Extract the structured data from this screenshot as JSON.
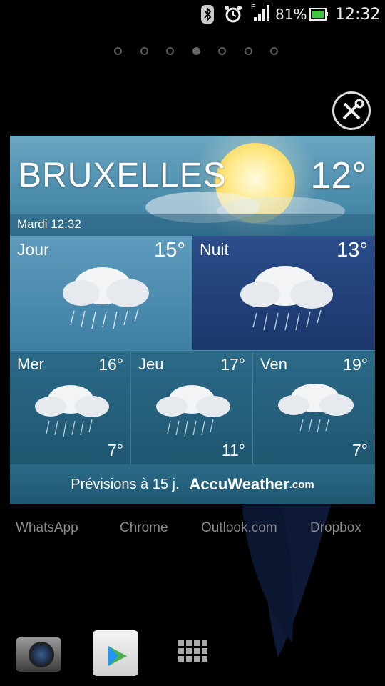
{
  "status_bar": {
    "battery_percent": "81%",
    "time": "12:32",
    "network_label": "E",
    "icons": [
      "bluetooth-icon",
      "alarm-icon",
      "signal-icon",
      "battery-icon"
    ]
  },
  "home": {
    "page_count": 7,
    "active_page": 3,
    "app_labels": [
      "WhatsApp",
      "Chrome",
      "Outlook.com",
      "Dropbox"
    ]
  },
  "widget": {
    "city": "BRUXELLES",
    "current_temp": "12°",
    "date_time": "Mardi 12:32",
    "today": {
      "label": "Jour",
      "temp": "15°"
    },
    "night": {
      "label": "Nuit",
      "temp": "13°"
    },
    "forecast": [
      {
        "day": "Mer",
        "high": "16°",
        "low": "7°"
      },
      {
        "day": "Jeu",
        "high": "17°",
        "low": "11°"
      },
      {
        "day": "Ven",
        "high": "19°",
        "low": "7°"
      }
    ],
    "footer_text": "Prévisions à 15 j.",
    "brand": "AccuWeather",
    "brand_suffix": ".com"
  },
  "colors": {
    "widget_bg": "#1d5f7c",
    "night_bg": "#1f3f78",
    "sun": "#ffe98a"
  }
}
